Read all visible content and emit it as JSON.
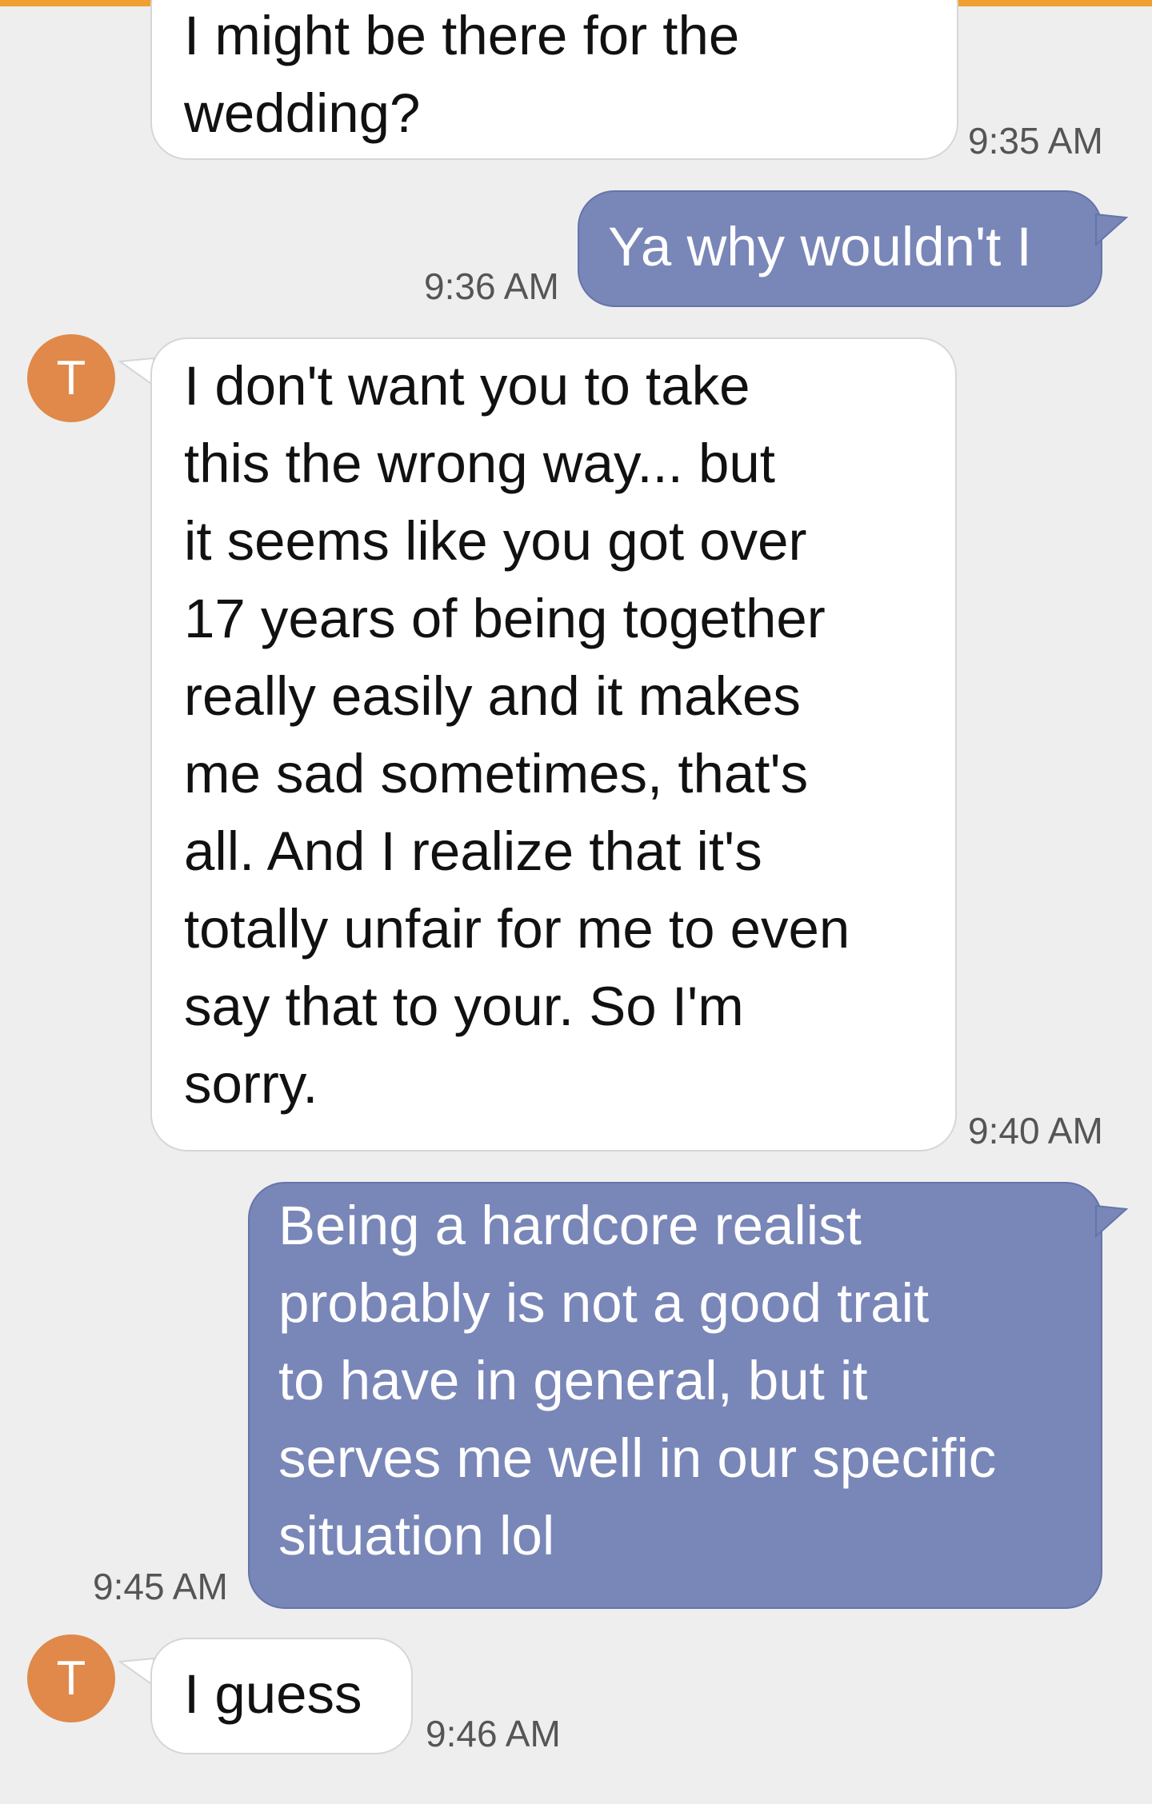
{
  "theme": {
    "avatar_color": "#e0894a",
    "incoming_bubble": "#ffffff",
    "outgoing_bubble": "#7986b8",
    "accent": "#f0a030"
  },
  "messages": [
    {
      "sender": "contact",
      "text": "I might be there for the\nwedding?",
      "time": "9:35 AM"
    },
    {
      "sender": "me",
      "text": "Ya why wouldn't I",
      "time": "9:36 AM"
    },
    {
      "sender": "contact",
      "avatar": "T",
      "text": "I don't want you to take\nthis the wrong way... but\nit seems like you got over\n17 years of being together\nreally easily and it makes\nme sad sometimes, that's\nall.  And I realize that it's\ntotally unfair for me to even\nsay that to your. So I'm\nsorry.",
      "time": "9:40 AM"
    },
    {
      "sender": "me",
      "text": "Being a hardcore realist\nprobably is not a good trait\nto have in general, but it\nserves me well in our specific\nsituation lol",
      "time": "9:45 AM"
    },
    {
      "sender": "contact",
      "avatar": "T",
      "text": "I guess",
      "time": "9:46 AM"
    }
  ]
}
